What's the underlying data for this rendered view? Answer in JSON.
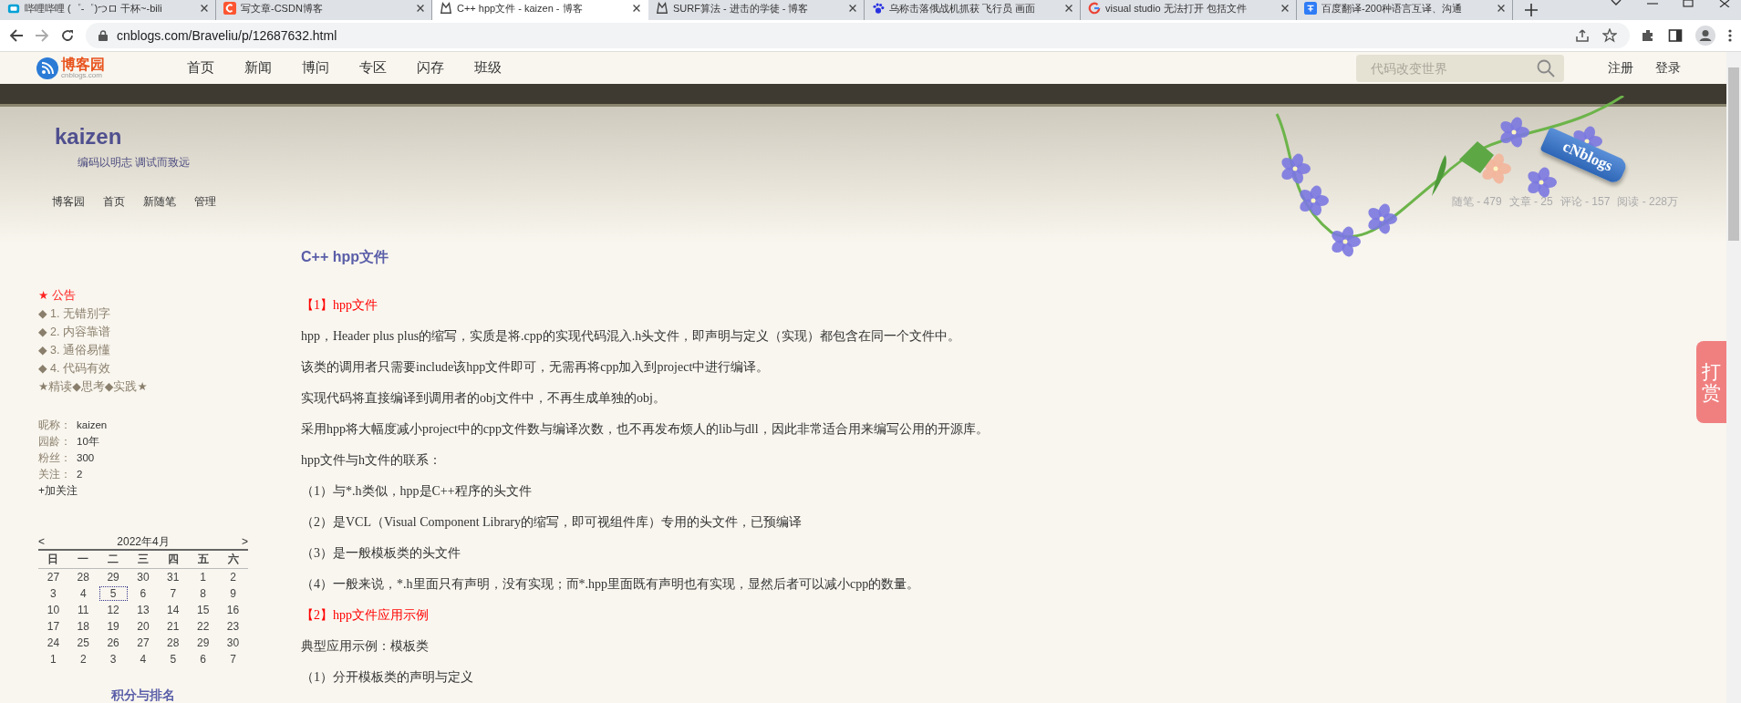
{
  "browser": {
    "tabs": [
      {
        "title": "哔哩哔哩 (゜-゜)つロ 干杯~-bili",
        "selected": false
      },
      {
        "title": "写文章-CSDN博客",
        "selected": false
      },
      {
        "title": "C++ hpp文件 - kaizen - 博客",
        "selected": true
      },
      {
        "title": "SURF算法 - 进击的学徒 - 博客",
        "selected": false
      },
      {
        "title": "乌称击落俄战机抓获 飞行员 画面",
        "selected": false
      },
      {
        "title": "visual studio 无法打开 包括文件",
        "selected": false
      },
      {
        "title": "百度翻译-200种语言互译、沟通",
        "selected": false
      }
    ],
    "address": "cnblogs.com/Braveliu/p/12687632.html"
  },
  "site_nav": {
    "logo": {
      "name": "博客园",
      "domain": "cnblogs.com"
    },
    "items": [
      "首页",
      "新闻",
      "博问",
      "专区",
      "闪存",
      "班级"
    ],
    "search": {
      "placeholder": "代码改变世界"
    },
    "account": [
      "注册",
      "登录"
    ]
  },
  "blog": {
    "title": "kaizen",
    "subtitle": "编码以明志 调试而致远",
    "nav": [
      "博客园",
      "首页",
      "新随笔",
      "管理"
    ],
    "stats": [
      "随笔 - 479",
      "文章 - 25",
      "评论 - 157",
      "阅读 - 228万"
    ],
    "tag": "cNblogs"
  },
  "sidebar": {
    "notice": {
      "heading": "★ 公告",
      "items": [
        "◆ 1. 无错别字",
        "◆ 2. 内容靠谱",
        "◆ 3. 通俗易懂",
        "◆ 4. 代码有效"
      ],
      "motto": "★精读◆思考◆实践★"
    },
    "profile": [
      {
        "label": "昵称：",
        "value": "kaizen"
      },
      {
        "label": "园龄：",
        "value": "10年"
      },
      {
        "label": "粉丝：",
        "value": "300"
      },
      {
        "label": "关注：",
        "value": "2"
      }
    ],
    "follow": "+加关注",
    "calendar": {
      "prev": "<",
      "month": "2022年4月",
      "next": ">",
      "weekdays": [
        "日",
        "一",
        "二",
        "三",
        "四",
        "五",
        "六"
      ],
      "weeks": [
        [
          {
            "day": "27",
            "selected": false
          },
          {
            "day": "28",
            "selected": false
          },
          {
            "day": "29",
            "selected": false
          },
          {
            "day": "30",
            "selected": false
          },
          {
            "day": "31",
            "selected": false
          },
          {
            "day": "1",
            "selected": false
          },
          {
            "day": "2",
            "selected": false
          }
        ],
        [
          {
            "day": "3",
            "selected": false
          },
          {
            "day": "4",
            "selected": false
          },
          {
            "day": "5",
            "selected": true
          },
          {
            "day": "6",
            "selected": false
          },
          {
            "day": "7",
            "selected": false
          },
          {
            "day": "8",
            "selected": false
          },
          {
            "day": "9",
            "selected": false
          }
        ],
        [
          {
            "day": "10",
            "selected": false
          },
          {
            "day": "11",
            "selected": false
          },
          {
            "day": "12",
            "selected": false
          },
          {
            "day": "13",
            "selected": false
          },
          {
            "day": "14",
            "selected": false
          },
          {
            "day": "15",
            "selected": false
          },
          {
            "day": "16",
            "selected": false
          }
        ],
        [
          {
            "day": "17",
            "selected": false
          },
          {
            "day": "18",
            "selected": false
          },
          {
            "day": "19",
            "selected": false
          },
          {
            "day": "20",
            "selected": false
          },
          {
            "day": "21",
            "selected": false
          },
          {
            "day": "22",
            "selected": false
          },
          {
            "day": "23",
            "selected": false
          }
        ],
        [
          {
            "day": "24",
            "selected": false
          },
          {
            "day": "25",
            "selected": false
          },
          {
            "day": "26",
            "selected": false
          },
          {
            "day": "27",
            "selected": false
          },
          {
            "day": "28",
            "selected": false
          },
          {
            "day": "29",
            "selected": false
          },
          {
            "day": "30",
            "selected": false
          }
        ],
        [
          {
            "day": "1",
            "selected": false
          },
          {
            "day": "2",
            "selected": false
          },
          {
            "day": "3",
            "selected": false
          },
          {
            "day": "4",
            "selected": false
          },
          {
            "day": "5",
            "selected": false
          },
          {
            "day": "6",
            "selected": false
          },
          {
            "day": "7",
            "selected": false
          }
        ]
      ]
    },
    "ranking_heading": "积分与排名"
  },
  "article": {
    "title": "C++ hpp文件",
    "blocks": [
      {
        "kind": "heading",
        "text": "【1】hpp文件"
      },
      {
        "kind": "paragraph",
        "text": "hpp，Header plus plus的缩写，实质是将.cpp的实现代码混入.h头文件，即声明与定义（实现）都包含在同一个文件中。"
      },
      {
        "kind": "paragraph",
        "text": "该类的调用者只需要include该hpp文件即可，无需再将cpp加入到project中进行编译。"
      },
      {
        "kind": "paragraph",
        "text": "实现代码将直接编译到调用者的obj文件中，不再生成单独的obj。"
      },
      {
        "kind": "paragraph",
        "text": "采用hpp将大幅度减小project中的cpp文件数与编译次数，也不再发布烦人的lib与dll，因此非常适合用来编写公用的开源库。"
      },
      {
        "kind": "paragraph",
        "text": "hpp文件与h文件的联系："
      },
      {
        "kind": "paragraph",
        "text": "（1）与*.h类似，hpp是C++程序的头文件"
      },
      {
        "kind": "paragraph",
        "text": "（2）是VCL（Visual Component Library的缩写，即可视组件库）专用的头文件，已预编译"
      },
      {
        "kind": "paragraph",
        "text": "（3）是一般模板类的头文件"
      },
      {
        "kind": "paragraph",
        "text": "（4）一般来说，*.h里面只有声明，没有实现；而*.hpp里面既有声明也有实现，显然后者可以减小cpp的数量。"
      },
      {
        "kind": "heading",
        "text": "【2】hpp文件应用示例"
      },
      {
        "kind": "paragraph",
        "text": "典型应用示例：模板类"
      },
      {
        "kind": "paragraph",
        "text": "（1）分开模板类的声明与定义"
      }
    ]
  },
  "reward_button": "打赏"
}
